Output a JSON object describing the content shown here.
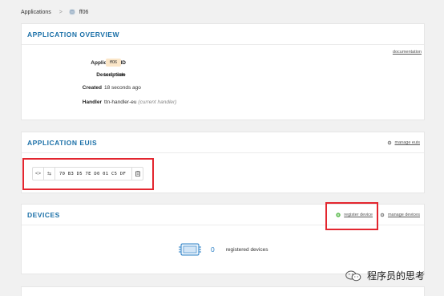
{
  "breadcrumb": {
    "root": "Applications",
    "separator": ">",
    "current": "ff06"
  },
  "overview": {
    "title": "APPLICATION OVERVIEW",
    "doc_link": "documentation",
    "fields": {
      "app_id_label": "Application ID",
      "app_id_value": "ff06",
      "description_label": "Description",
      "description_value": "test node",
      "created_label": "Created",
      "created_value": "18 seconds ago",
      "handler_label": "Handler",
      "handler_value": "ttn-handler-eu",
      "handler_note": "(current handler)"
    }
  },
  "euis": {
    "title": "APPLICATION EUIS",
    "manage_label": "manage euis",
    "eui_value": "70 B3 D5 7E D0 01 C5 DF"
  },
  "devices": {
    "title": "DEVICES",
    "register_label": "register device",
    "manage_label": "manage devices",
    "count": "0",
    "count_label": "registered devices"
  },
  "watermark": {
    "text": "程序员的思考"
  },
  "colors": {
    "accent": "#1b70a8",
    "badge_bg": "#fbe6c8",
    "badge_fg": "#c9801f",
    "highlight": "#e3262f",
    "register_icon": "#56b848"
  }
}
